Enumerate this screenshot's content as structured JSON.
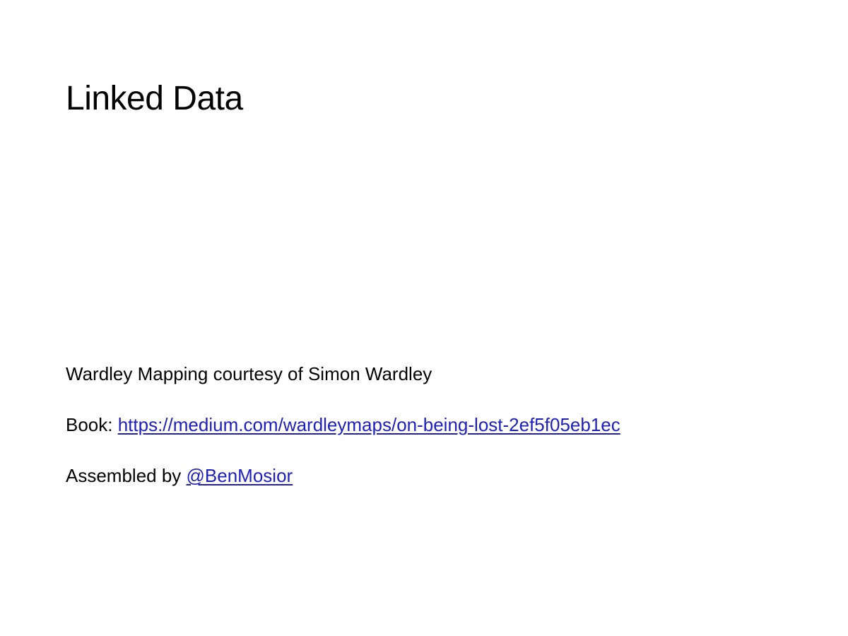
{
  "slide": {
    "title": "Linked Data",
    "credit_line": "Wardley Mapping courtesy of Simon Wardley",
    "book": {
      "prefix": "Book: ",
      "link_text": "https://medium.com/wardleymaps/on-being-lost-2ef5f05eb1ec"
    },
    "assembled": {
      "prefix": "Assembled by ",
      "link_text": "@BenMosior "
    }
  },
  "colors": {
    "background": "#ffffff",
    "text": "#000000",
    "link": "#1f1fbf"
  }
}
